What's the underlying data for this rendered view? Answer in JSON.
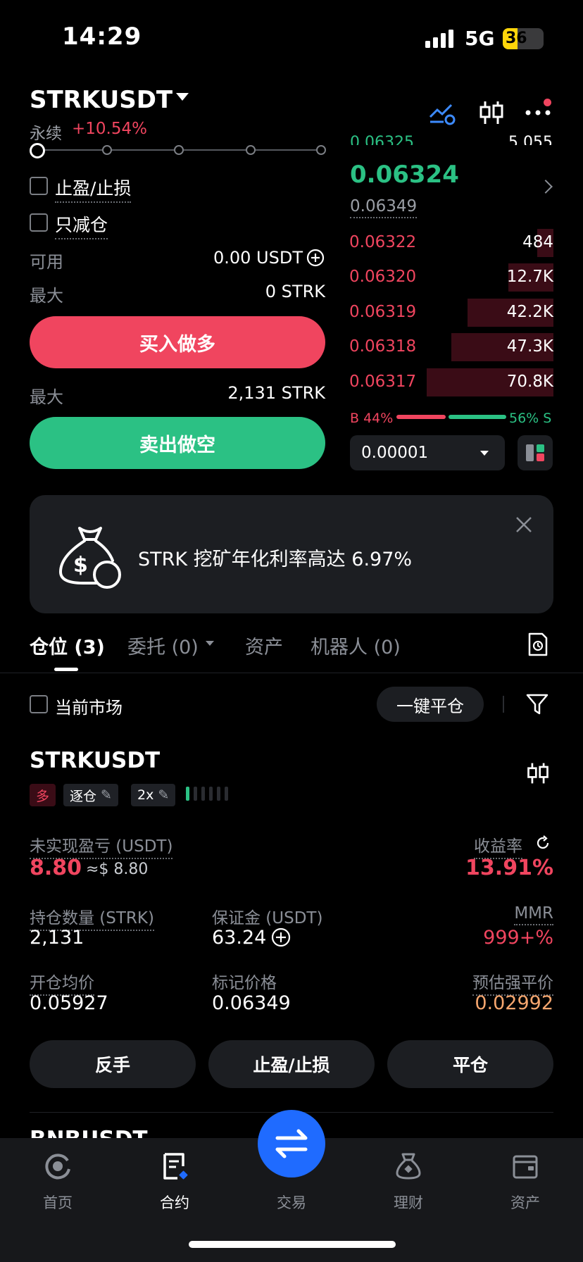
{
  "status_bar": {
    "time": "14:29",
    "network": "5G",
    "battery": "36"
  },
  "header": {
    "pair": "STRKUSDT",
    "contract_type": "永续",
    "change": "+10.54%",
    "icons": [
      "trend-settings-icon",
      "candlestick-chart-icon",
      "more-icon"
    ]
  },
  "order_form": {
    "tpsl_label": "止盈/止损",
    "reduce_only_label": "只减仓",
    "available_label": "可用",
    "available_value": "0.00 USDT",
    "max_long_label": "最大",
    "max_long_value": "0 STRK",
    "buy_button": "买入做多",
    "max_short_label": "最大",
    "max_short_value": "2,131 STRK",
    "sell_button": "卖出做空"
  },
  "order_book": {
    "partial_top_price": "0.06325",
    "partial_top_qty": "5,055",
    "last_price": "0.06324",
    "mark_price": "0.06349",
    "asks": [
      {
        "price": "0.06322",
        "qty": "484",
        "depth": 0.08
      },
      {
        "price": "0.06320",
        "qty": "12.7K",
        "depth": 0.22
      },
      {
        "price": "0.06319",
        "qty": "42.2K",
        "depth": 0.42
      },
      {
        "price": "0.06318",
        "qty": "47.3K",
        "depth": 0.5
      },
      {
        "price": "0.06317",
        "qty": "70.8K",
        "depth": 0.62
      }
    ],
    "buy_ratio": "B 44%",
    "sell_ratio": "56% S",
    "buy_ratio_value": 44,
    "sell_ratio_value": 56,
    "precision": "0.00001"
  },
  "banner": {
    "text": "STRK 挖矿年化利率高达 6.97%"
  },
  "tabs": [
    {
      "label": "仓位 (3)",
      "active": true
    },
    {
      "label": "委托 (0)",
      "active": false
    },
    {
      "label": "资产",
      "active": false
    },
    {
      "label": "机器人 (0)",
      "active": false
    }
  ],
  "filter_row": {
    "current_market_label": "当前市场",
    "close_all_button": "一键平仓"
  },
  "position": {
    "symbol": "STRKUSDT",
    "side_tag": "多",
    "margin_mode": "逐仓",
    "leverage": "2x",
    "leverage_level": 1,
    "upnl_label": "未实现盈亏 (USDT)",
    "upnl_value": "8.80",
    "upnl_fiat": "≈$ 8.80",
    "roe_label": "收益率",
    "roe_value": "13.91%",
    "size_label": "持仓数量 (STRK)",
    "size_value": "2,131",
    "margin_label": "保证金 (USDT)",
    "margin_value": "63.24",
    "mmr_label": "MMR",
    "mmr_value": "999+%",
    "entry_label": "开仓均价",
    "entry_value": "0.05927",
    "mark_label": "标记价格",
    "mark_value": "0.06349",
    "liq_label": "预估强平价",
    "liq_value": "0.02992",
    "reverse_button": "反手",
    "tpsl_button": "止盈/止损",
    "close_button": "平仓"
  },
  "next_position": {
    "symbol": "BNBUSDT"
  },
  "bottom_nav": {
    "items": [
      {
        "label": "首页",
        "icon": "home-icon",
        "active": false
      },
      {
        "label": "合约",
        "icon": "contract-icon",
        "active": true
      },
      {
        "label": "交易",
        "icon": "trade-swap-icon",
        "active": false
      },
      {
        "label": "理财",
        "icon": "earn-icon",
        "active": false
      },
      {
        "label": "资产",
        "icon": "wallet-icon",
        "active": false
      }
    ]
  }
}
